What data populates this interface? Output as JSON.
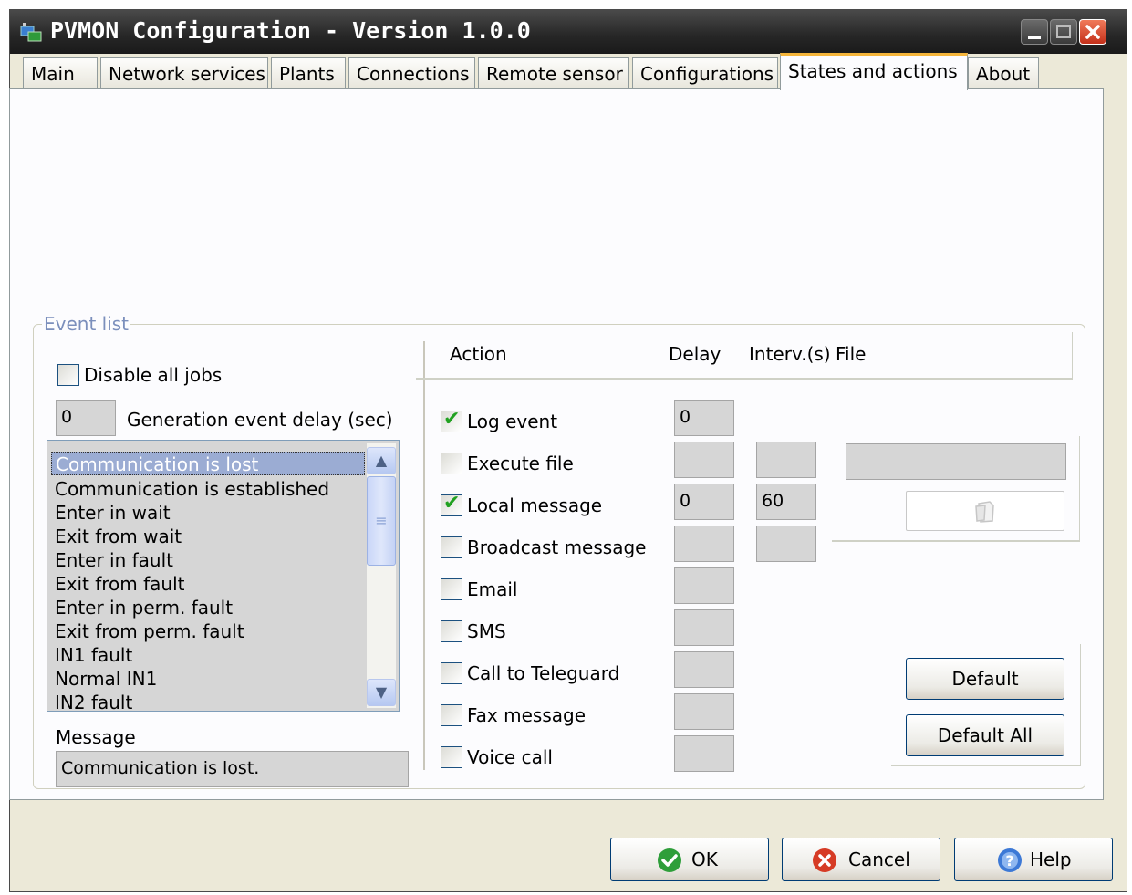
{
  "window": {
    "title": "PVMON Configuration - Version 1.0.0"
  },
  "tabs": [
    {
      "label": "Main"
    },
    {
      "label": "Network services"
    },
    {
      "label": "Plants"
    },
    {
      "label": "Connections"
    },
    {
      "label": "Remote sensor"
    },
    {
      "label": "Configurations"
    },
    {
      "label": "States and actions",
      "active": true
    },
    {
      "label": "About"
    }
  ],
  "event_group": {
    "label": "Event list",
    "disable_all_jobs": {
      "label": "Disable all jobs",
      "checked": false
    },
    "generation_delay": {
      "value": "0",
      "label": "Generation event delay (sec)"
    },
    "events": [
      "Communication is lost",
      "Communication is established",
      "Enter in wait",
      "Exit from wait",
      "Enter in fault",
      "Exit from fault",
      "Enter in perm. fault",
      "Exit from perm. fault",
      "IN1 fault",
      "Normal IN1",
      "IN2 fault"
    ],
    "selected_event": "Communication is lost",
    "message_label": "Message",
    "message_value": "Communication is lost."
  },
  "actions_header": {
    "action": "Action",
    "delay": "Delay",
    "interval": "Interv.(s)",
    "file": "File"
  },
  "actions": [
    {
      "label": "Log event",
      "checked": true,
      "delay": "0"
    },
    {
      "label": "Execute file",
      "checked": false,
      "delay": "",
      "interval": ""
    },
    {
      "label": "Local message",
      "checked": true,
      "delay": "0",
      "interval": "60"
    },
    {
      "label": "Broadcast message",
      "checked": false,
      "delay": "",
      "interval": ""
    },
    {
      "label": "Email",
      "checked": false,
      "delay": ""
    },
    {
      "label": "SMS",
      "checked": false,
      "delay": ""
    },
    {
      "label": "Call to Teleguard",
      "checked": false,
      "delay": ""
    },
    {
      "label": "Fax message",
      "checked": false,
      "delay": ""
    },
    {
      "label": "Voice call",
      "checked": false,
      "delay": ""
    }
  ],
  "file": {
    "path": "",
    "browse_icon": "open-file-icon"
  },
  "buttons": {
    "default": "Default",
    "default_all": "Default All",
    "ok": "OK",
    "cancel": "Cancel",
    "help": "Help"
  },
  "colors": {
    "title_bar": "#262626",
    "selection": "#9bacd3",
    "tab_accent": "#f5b53a",
    "check_mark": "#21a121"
  }
}
